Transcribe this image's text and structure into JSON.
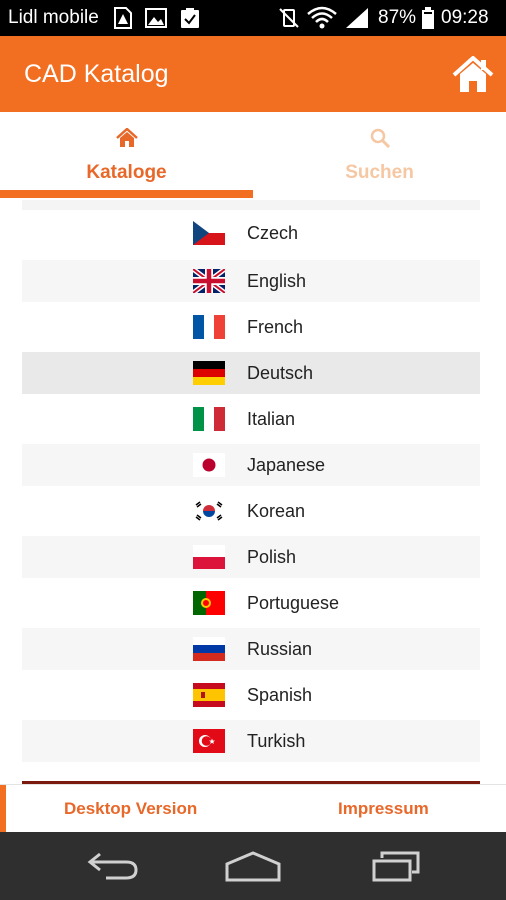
{
  "status_bar": {
    "carrier": "Lidl mobile",
    "battery_percent": "87%",
    "time": "09:28"
  },
  "app_bar": {
    "title": "CAD Katalog",
    "home_icon": "home-icon"
  },
  "tabs": [
    {
      "label": "Kataloge",
      "icon": "home-icon",
      "active": true
    },
    {
      "label": "Suchen",
      "icon": "search-icon",
      "active": false
    }
  ],
  "languages": [
    {
      "label": "Czech",
      "flag": "czech-flag"
    },
    {
      "label": "English",
      "flag": "uk-flag"
    },
    {
      "label": "French",
      "flag": "france-flag"
    },
    {
      "label": "Deutsch",
      "flag": "germany-flag",
      "selected": true
    },
    {
      "label": "Italian",
      "flag": "italy-flag"
    },
    {
      "label": "Japanese",
      "flag": "japan-flag"
    },
    {
      "label": "Korean",
      "flag": "korea-flag"
    },
    {
      "label": "Polish",
      "flag": "poland-flag"
    },
    {
      "label": "Portuguese",
      "flag": "portugal-flag"
    },
    {
      "label": "Russian",
      "flag": "russia-flag"
    },
    {
      "label": "Spanish",
      "flag": "spain-flag"
    },
    {
      "label": "Turkish",
      "flag": "turkey-flag"
    }
  ],
  "footer": {
    "desktop_label": "Desktop Version",
    "impressum_label": "Impressum"
  },
  "colors": {
    "accent": "#f26e21",
    "accent_text": "#e8682a",
    "inactive_tab_text": "#f6c7a3",
    "status_bar": "#000000",
    "nav_bar": "#2f2f2f"
  }
}
